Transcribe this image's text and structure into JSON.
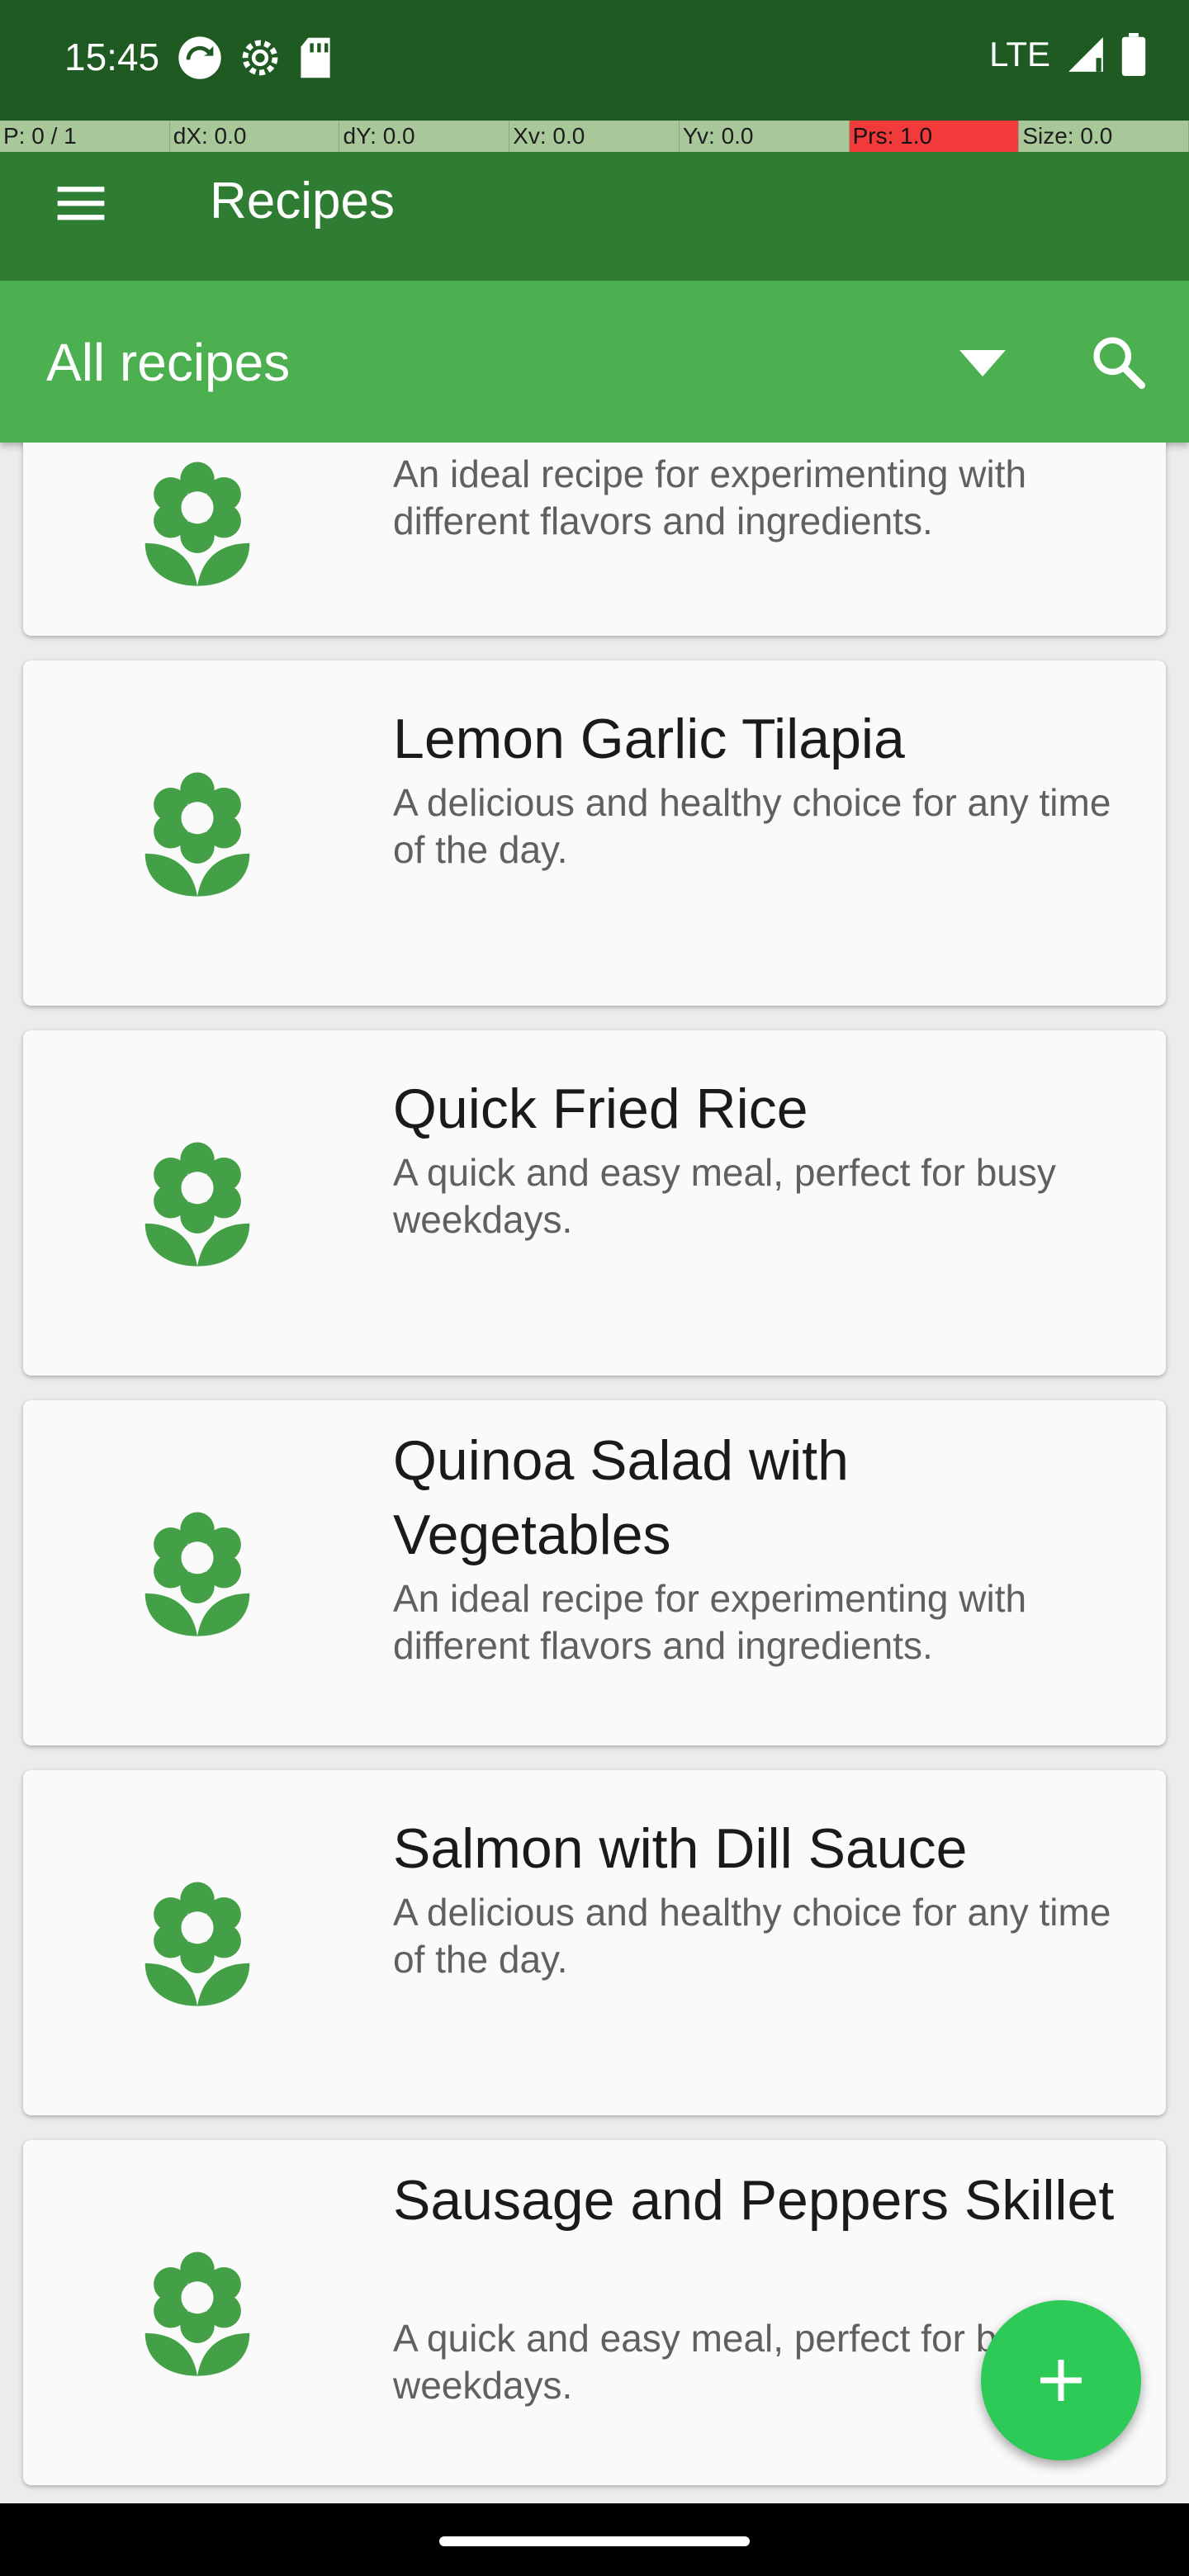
{
  "status_bar": {
    "time": "15:45",
    "network": "LTE",
    "icons": [
      "sync-icon",
      "settings-icon",
      "sd-card-icon",
      "signal-icon",
      "battery-icon"
    ]
  },
  "debug_bar": {
    "cells": [
      "P: 0 / 1",
      "dX: 0.0",
      "dY: 0.0",
      "Xv: 0.0",
      "Yv: 0.0",
      "Prs: 1.0",
      "Size: 0.0"
    ]
  },
  "app_bar": {
    "title": "Recipes"
  },
  "filter": {
    "selected": "All recipes"
  },
  "recipes": [
    {
      "title": "",
      "description": "An ideal recipe for experimenting with different flavors and ingredients."
    },
    {
      "title": "Lemon Garlic Tilapia",
      "description": "A delicious and healthy choice for any time of the day."
    },
    {
      "title": "Quick Fried Rice",
      "description": "A quick and easy meal, perfect for busy weekdays."
    },
    {
      "title": "Quinoa Salad with Vegetables",
      "description": "An ideal recipe for experimenting with different flavors and ingredients."
    },
    {
      "title": "Salmon with Dill Sauce",
      "description": "A delicious and healthy choice for any time of the day."
    },
    {
      "title": "Sausage and Peppers Skillet",
      "description": "A quick and easy meal, perfect for busy weekdays."
    }
  ],
  "colors": {
    "status_bar": "#1e5a22",
    "app_bar": "#2f7d32",
    "filter_bar": "#4caf50",
    "fab": "#2eca58",
    "icon": "#43a047"
  }
}
